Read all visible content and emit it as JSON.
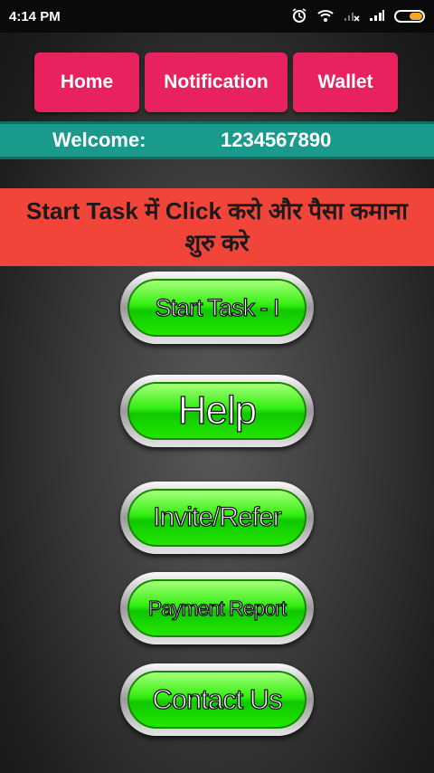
{
  "status_bar": {
    "time": "4:14 PM",
    "signal_text": "..ıl"
  },
  "nav": {
    "home_label": "Home",
    "notification_label": "Notification",
    "wallet_label": "Wallet"
  },
  "welcome": {
    "label": "Welcome:",
    "user_id": "1234567890"
  },
  "banner": {
    "text": "Start Task में Click करो और पैसा कमाना शुरु करे"
  },
  "menu": [
    {
      "label": "Start Task - I"
    },
    {
      "label": "Help"
    },
    {
      "label": "Invite/Refer"
    },
    {
      "label": "Payment Report"
    },
    {
      "label": "Contact Us"
    }
  ],
  "colors": {
    "nav_button": "#e8225e",
    "welcome_bar": "#1a9a8a",
    "banner": "#f1453a",
    "menu_button_green": "#22e600"
  }
}
